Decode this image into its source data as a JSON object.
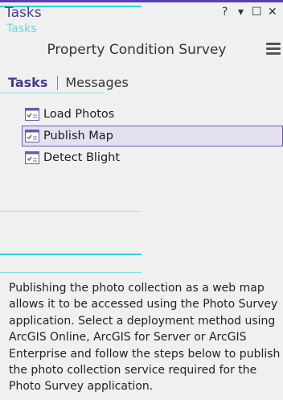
{
  "panel": {
    "title": "Tasks",
    "controls": {
      "help": "?",
      "dropdown": "▾",
      "maximize": "☐",
      "close": "✕"
    }
  },
  "task": {
    "title": "Property Condition Survey"
  },
  "tabs": [
    {
      "label": "Tasks",
      "active": true
    },
    {
      "label": "Messages",
      "active": false
    }
  ],
  "task_items": [
    {
      "label": "Load Photos",
      "selected": false
    },
    {
      "label": "Publish Map",
      "selected": true
    },
    {
      "label": "Detect Blight",
      "selected": false
    }
  ],
  "description": "Publishing the photo collection as a web map allows it to be accessed using the Photo Survey application. Select a deployment method using ArcGIS Online, ArcGIS for Server or ArcGIS Enterprise and follow the steps below to publish the photo collection service required for the Photo Survey application.",
  "colors": {
    "accent": "#4a3a8c",
    "artifact": "#2fd3d8"
  }
}
